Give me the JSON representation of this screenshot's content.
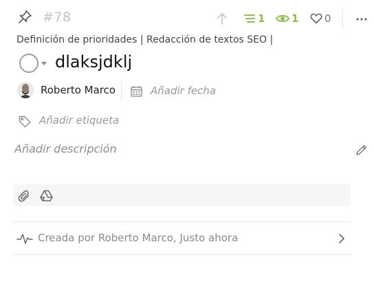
{
  "header": {
    "task_id": "#78",
    "subtasks_count": "1",
    "followers_count": "1",
    "likes_count": "0",
    "accent_color": "#8bc34a",
    "icons": [
      "pin-icon",
      "upvote-arrow-icon",
      "subtasks-list-icon",
      "eye-icon",
      "heart-icon",
      "more-icon"
    ]
  },
  "breadcrumb": "Definición de prioridades | Redacción de textos SEO |",
  "task": {
    "title": "dlaksjdklj"
  },
  "assignee": {
    "name": "Roberto Marco"
  },
  "due_date": {
    "placeholder": "Añadir fecha"
  },
  "tags": {
    "placeholder": "Añadir etiqueta"
  },
  "description": {
    "placeholder": "Añadir descripción"
  },
  "activity": {
    "text": "Creada por Roberto Marco, Justo ahora"
  }
}
